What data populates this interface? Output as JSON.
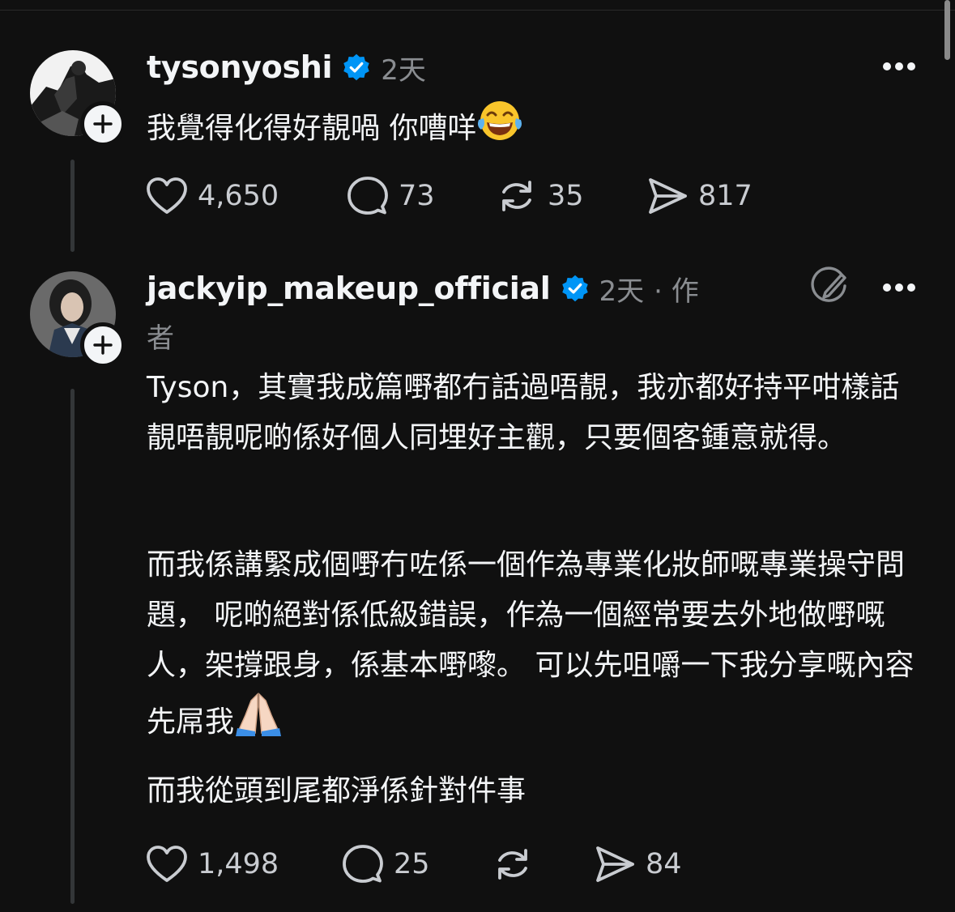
{
  "comments": [
    {
      "username": "tysonyoshi",
      "time": "2天",
      "text": "我覺得化得好靚喎 你嘈咩",
      "emoji": "tears-of-joy-emoji",
      "likes": "4,650",
      "replies": "73",
      "reposts": "35",
      "shares": "817"
    },
    {
      "username": "jackyip_makeup_official",
      "time": "2天",
      "author_tag": "· 作",
      "author_tag_cont": "者",
      "paragraph1": "Tyson，其實我成篇嘢都冇話過唔靚，我亦都好持平咁樣話靚唔靚呢啲係好個人同埋好主觀，只要個客鍾意就得。",
      "paragraph2": "而我係講緊成個嘢冇咗係一個作為專業化妝師嘅專業操守問題， 呢啲絕對係低級錯誤，作為一個經常要去外地做嘢嘅人，架撐跟身，係基本嘢嚟。 可以先咀嚼一下我分享嘅內容先屌我",
      "paragraph2_emoji": "folded-hands-emoji",
      "paragraph3": "而我從頭到尾都淨係針對件事",
      "likes": "1,498",
      "replies": "25",
      "reposts": "",
      "shares": "84"
    }
  ],
  "colors": {
    "background": "#101010",
    "text": "#f3f5f7",
    "muted": "#8a8d91",
    "verified": "#0095f6"
  }
}
